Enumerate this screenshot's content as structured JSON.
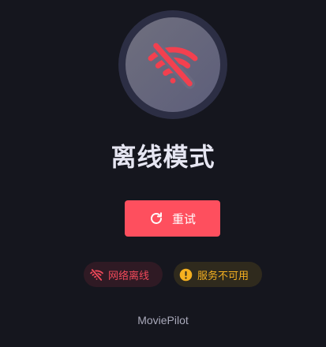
{
  "status": {
    "icon": "wifi-off-icon",
    "title": "离线模式"
  },
  "actions": {
    "retry_icon": "refresh-icon",
    "retry_label": "重试"
  },
  "chips": {
    "network": {
      "icon": "wifi-off-icon",
      "label": "网络离线"
    },
    "service": {
      "icon": "alert-circle-icon",
      "label": "服务不可用"
    }
  },
  "footer": {
    "app_name": "MoviePilot"
  },
  "colors": {
    "background": "#15161e",
    "accent_red": "#fe4f5e",
    "warning_amber": "#f5b020"
  }
}
